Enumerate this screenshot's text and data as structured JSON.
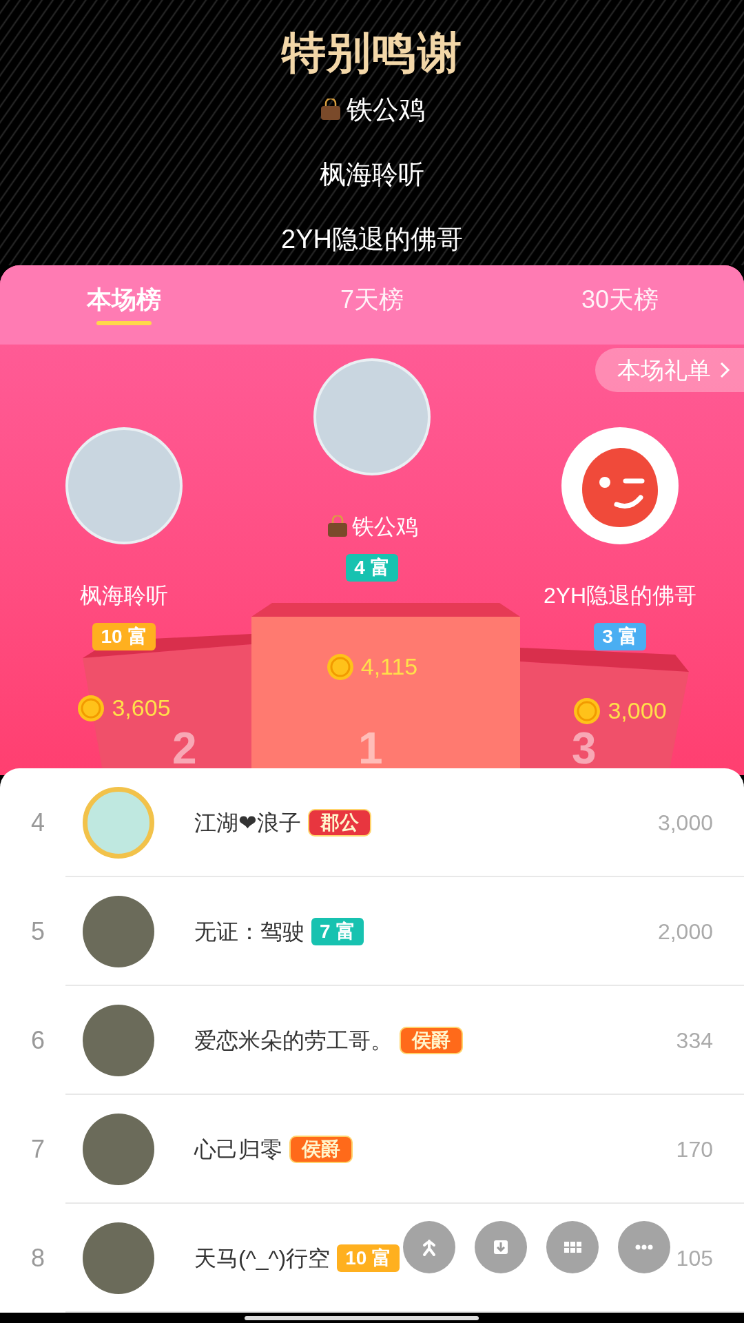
{
  "header": {
    "title": "特别鸣谢",
    "credits": [
      {
        "name": "铁公鸡",
        "kind": "with-icon"
      },
      {
        "name": "枫海聆听",
        "kind": "plain"
      },
      {
        "name": "2YH隐退的佛哥",
        "kind": "plain"
      }
    ]
  },
  "tabs": [
    {
      "label": "本场榜",
      "selected": true
    },
    {
      "label": "7天榜",
      "selected": false
    },
    {
      "label": "30天榜",
      "selected": false
    }
  ],
  "gift_list_button": {
    "label": "本场礼单"
  },
  "podium": [
    {
      "podium_label": "2",
      "name": "枫海聆听",
      "has_bag_icon": false,
      "default_avatar": false,
      "badge": {
        "kind": "wealth",
        "level": "10",
        "text": "富",
        "color": "#ffb01f"
      },
      "score": "3,605"
    },
    {
      "podium_label": "1",
      "name": "铁公鸡",
      "has_bag_icon": true,
      "default_avatar": false,
      "badge": {
        "kind": "wealth",
        "level": "4",
        "text": "富",
        "color": "#17c2b0"
      },
      "score": "4,115"
    },
    {
      "podium_label": "3",
      "name": "2YH隐退的佛哥",
      "has_bag_icon": false,
      "default_avatar": true,
      "badge": {
        "kind": "wealth",
        "level": "3",
        "text": "富",
        "color": "#4aaef2"
      },
      "score": "3,000"
    }
  ],
  "ranking": [
    {
      "rank": "4",
      "name": "江湖❤浪子",
      "avatar_frame": true,
      "badge": {
        "kind": "title",
        "text": "郡公",
        "color": "#e8363f"
      },
      "score": "3,000"
    },
    {
      "rank": "5",
      "name": "无证：驾驶",
      "avatar_frame": false,
      "badge": {
        "kind": "wealth",
        "level": "7",
        "text": "富",
        "color": "#17c2b0"
      },
      "score": "2,000"
    },
    {
      "rank": "6",
      "name": "爱恋米朵的劳工哥。",
      "avatar_frame": false,
      "badge": {
        "kind": "title",
        "text": "侯爵",
        "color": "#ff6a1a"
      },
      "score": "334"
    },
    {
      "rank": "7",
      "name": "心己归零",
      "avatar_frame": false,
      "badge": {
        "kind": "title",
        "text": "侯爵",
        "color": "#ff6a1a"
      },
      "score": "170"
    },
    {
      "rank": "8",
      "name": "天马(^_^)行空",
      "avatar_frame": false,
      "badge": {
        "kind": "wealth",
        "level": "10",
        "text": "富",
        "color": "#ffb01f"
      },
      "score": "105"
    }
  ]
}
